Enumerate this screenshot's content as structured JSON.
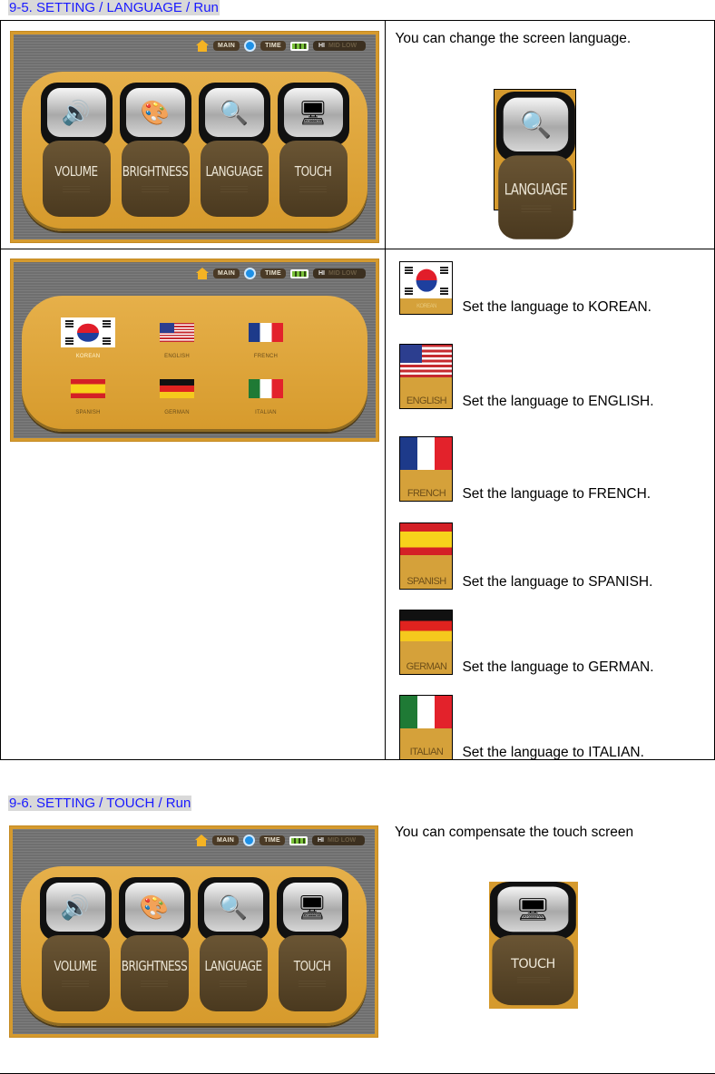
{
  "section_language": {
    "title": "9-5. SETTING / LANGUAGE / Run",
    "intro_text": "You can change the screen language.",
    "device_status": {
      "main": "MAIN",
      "time": "TIME",
      "hi": "HI",
      "hi_dim": "MID LOW"
    },
    "menu_tiles": [
      {
        "label": "VOLUME",
        "icon": "volume-icon"
      },
      {
        "label": "BRIGHTNESS",
        "icon": "brightness-icon"
      },
      {
        "label": "LANGUAGE",
        "icon": "language-icon"
      },
      {
        "label": "TOUCH",
        "icon": "touch-icon"
      }
    ],
    "highlight_tile": {
      "label": "LANGUAGE"
    },
    "language_screen": {
      "options": [
        {
          "name": "KOREAN",
          "selected": true
        },
        {
          "name": "ENGLISH",
          "selected": false
        },
        {
          "name": "FRENCH",
          "selected": false
        },
        {
          "name": "SPANISH",
          "selected": false
        },
        {
          "name": "GERMAN",
          "selected": false
        },
        {
          "name": "ITALIAN",
          "selected": false
        }
      ]
    },
    "language_descriptions": [
      {
        "thumb_label": "KOREAN",
        "text": "Set the language to KOREAN."
      },
      {
        "thumb_label": "ENGLISH",
        "text": "Set the language to ENGLISH."
      },
      {
        "thumb_label": "FRENCH",
        "text": "Set the language to FRENCH."
      },
      {
        "thumb_label": "SPANISH",
        "text": "Set the language to SPANISH."
      },
      {
        "thumb_label": "GERMAN",
        "text": "Set the language to GERMAN."
      },
      {
        "thumb_label": "ITALIAN",
        "text": "Set the language to ITALIAN."
      }
    ]
  },
  "section_touch": {
    "title": "9-6. SETTING / TOUCH / Run",
    "intro_text": "You can compensate the touch screen",
    "highlight_tile": {
      "label": "TOUCH"
    }
  },
  "colors": {
    "heading_blue": "#1a1aff",
    "heading_bg": "#d9d9d9",
    "device_gold": "#d59a2e",
    "tile_brown": "#4a391f"
  }
}
